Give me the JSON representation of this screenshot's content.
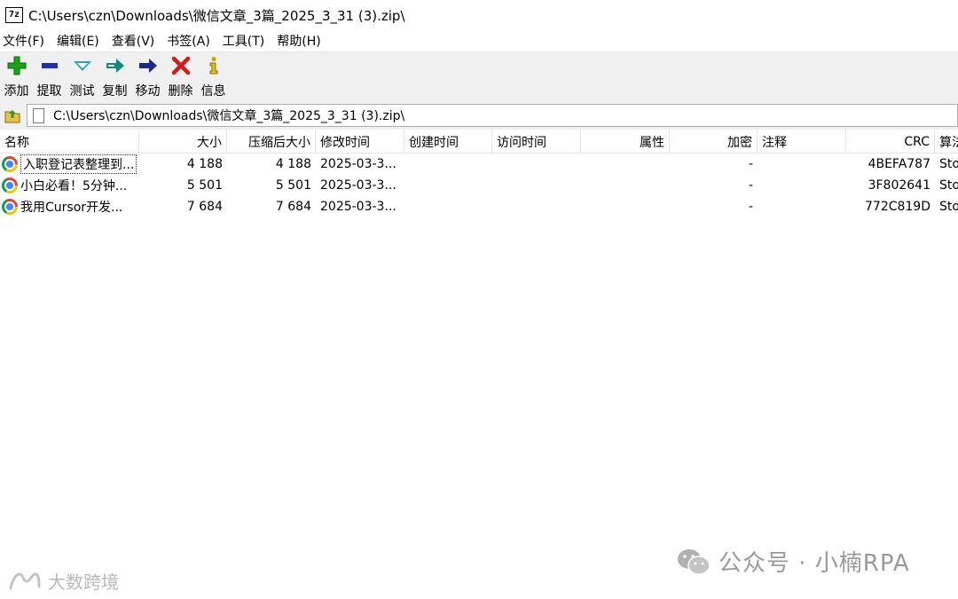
{
  "window": {
    "icon_label": "7z",
    "title": "C:\\Users\\czn\\Downloads\\微信文章_3篇_2025_3_31 (3).zip\\"
  },
  "menu": [
    "文件(F)",
    "编辑(E)",
    "查看(V)",
    "书签(A)",
    "工具(T)",
    "帮助(H)"
  ],
  "toolbar": [
    {
      "label": "添加",
      "icon": "add-icon",
      "color": "#1aa31a"
    },
    {
      "label": "提取",
      "icon": "extract-icon",
      "color": "#1c2fb0"
    },
    {
      "label": "测试",
      "icon": "test-icon",
      "color": "#2aa8b0"
    },
    {
      "label": "复制",
      "icon": "copy-icon",
      "color": "#0f8a7a"
    },
    {
      "label": "移动",
      "icon": "move-icon",
      "color": "#1b2a8a"
    },
    {
      "label": "删除",
      "icon": "delete-icon",
      "color": "#d11a1a"
    },
    {
      "label": "信息",
      "icon": "info-icon",
      "color": "#c9a400"
    }
  ],
  "address": {
    "path": "C:\\Users\\czn\\Downloads\\微信文章_3篇_2025_3_31 (3).zip\\"
  },
  "columns": [
    "名称",
    "大小",
    "压缩后大小",
    "修改时间",
    "创建时间",
    "访问时间",
    "属性",
    "加密",
    "注释",
    "CRC",
    "算法"
  ],
  "files": [
    {
      "name": "入职登记表整理到...",
      "size": "4 188",
      "packed": "4 188",
      "modified": "2025-03-3...",
      "created": "",
      "accessed": "",
      "attributes": "",
      "encrypted": "-",
      "comment": "",
      "crc": "4BEFA787",
      "method": "Store"
    },
    {
      "name": "小白必看！5分钟...",
      "size": "5 501",
      "packed": "5 501",
      "modified": "2025-03-3...",
      "created": "",
      "accessed": "",
      "attributes": "",
      "encrypted": "-",
      "comment": "",
      "crc": "3F802641",
      "method": "Store"
    },
    {
      "name": "我用Cursor开发...",
      "size": "7 684",
      "packed": "7 684",
      "modified": "2025-03-3...",
      "created": "",
      "accessed": "",
      "attributes": "",
      "encrypted": "-",
      "comment": "",
      "crc": "772C819D",
      "method": "Store"
    }
  ],
  "watermarks": {
    "right": "公众号 · 小楠RPA",
    "left": "大数跨境"
  }
}
